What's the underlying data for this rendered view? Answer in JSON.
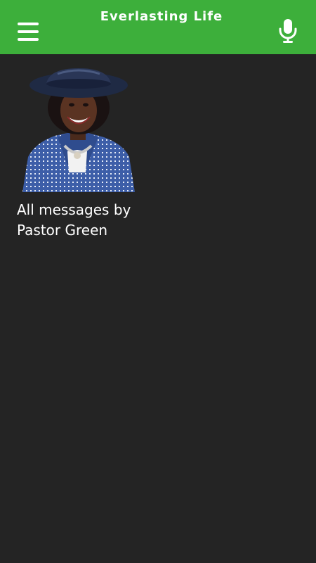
{
  "header": {
    "title": "Everlasting Life",
    "background_color": "#3daf3b",
    "menu_icon": "hamburger-menu-icon",
    "mic_icon": "microphone-icon"
  },
  "content": {
    "background_color": "#242424",
    "cards": [
      {
        "label": "All messages by Pastor Green"
      }
    ]
  }
}
